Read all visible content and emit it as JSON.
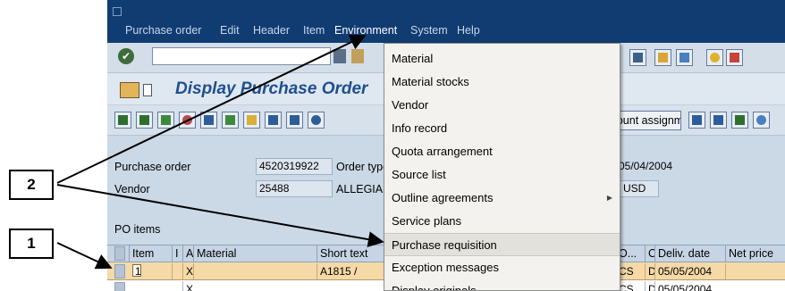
{
  "menubar": {
    "items": [
      "Purchase order",
      "Edit",
      "Header",
      "Item",
      "Environment",
      "System",
      "Help"
    ]
  },
  "title": "Display Purchase Order",
  "toolbar": {
    "account_assignments_label": "Account assignments"
  },
  "header": {
    "purchase_order_label": "Purchase order",
    "purchase_order_value": "4520319922",
    "order_type_label": "Order type",
    "vendor_label": "Vendor",
    "vendor_value": "25488",
    "vendor_name": "ALLEGIANCE",
    "doc_date": "05/04/2004",
    "currency": "USD"
  },
  "po_items_label": "PO items",
  "grid": {
    "columns": [
      "Item",
      "I",
      "A",
      "Material",
      "Short text",
      "O...",
      "C",
      "Deliv. date",
      "Net price"
    ],
    "rows": [
      {
        "item": "1",
        "a": "X",
        "short_text": "A1815 /",
        "unit": "CS",
        "c": "D",
        "deliv_date": "05/05/2004"
      },
      {
        "a": "X",
        "unit": "CS",
        "c": "D",
        "deliv_date": "05/05/2004"
      }
    ]
  },
  "environment_menu": {
    "items": [
      {
        "label": "Material"
      },
      {
        "label": "Material stocks"
      },
      {
        "label": "Vendor"
      },
      {
        "label": "Info record"
      },
      {
        "label": "Quota arrangement"
      },
      {
        "label": "Source list"
      },
      {
        "label": "Outline agreements",
        "submenu": true
      },
      {
        "label": "Service plans"
      },
      {
        "label": "Purchase requisition",
        "highlighted": true
      },
      {
        "label": "Exception messages"
      },
      {
        "label": "Display originals"
      }
    ]
  },
  "callouts": {
    "one": "1",
    "two": "2"
  }
}
